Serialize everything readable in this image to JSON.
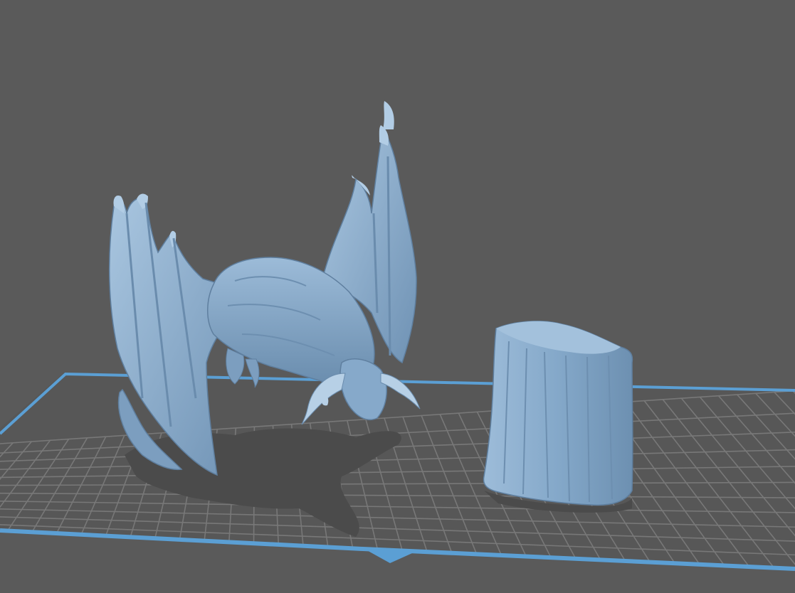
{
  "viewport": {
    "background_color": "#5a5a5a",
    "grid_line_color": "#787878",
    "plate_fill_color": "#575757",
    "plate_edge_color": "#5b9fd4",
    "model_color": "#8fb3d4",
    "model_shadow_color": "#5f7f9f",
    "shadow_color": "#4c4c4c"
  },
  "objects": [
    {
      "name": "dragon-model",
      "kind": "model"
    },
    {
      "name": "tree-stump-model",
      "kind": "model"
    }
  ]
}
